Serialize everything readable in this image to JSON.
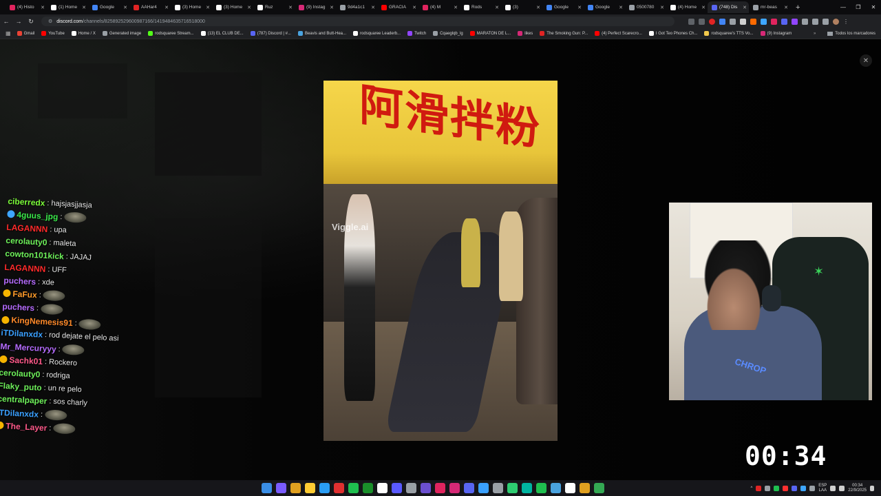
{
  "tabs": [
    {
      "title": "(4) Histo",
      "color": "#e0245e"
    },
    {
      "title": "(1) Home",
      "color": "#ffffff"
    },
    {
      "title": "Google",
      "color": "#4285f4"
    },
    {
      "title": "AAHar4",
      "color": "#e02424"
    },
    {
      "title": "(3) Home",
      "color": "#ffffff"
    },
    {
      "title": "(3) Home",
      "color": "#ffffff"
    },
    {
      "title": "Ruz",
      "color": "#ffffff"
    },
    {
      "title": "(9) Instag",
      "color": "#d62976"
    },
    {
      "title": "9d4a1c1",
      "color": "#9aa0a6"
    },
    {
      "title": "GRACIA",
      "color": "#ff0000"
    },
    {
      "title": "(4) M",
      "color": "#e0245e"
    },
    {
      "title": "Rods",
      "color": "#ffffff"
    },
    {
      "title": "(3)",
      "color": "#ffffff"
    },
    {
      "title": "Google",
      "color": "#4285f4"
    },
    {
      "title": "Google",
      "color": "#4285f4"
    },
    {
      "title": "0500780",
      "color": "#9aa0a6"
    },
    {
      "title": "(4) Home",
      "color": "#ffffff"
    },
    {
      "title": "(748) Dis",
      "color": "#5865f2",
      "active": true
    },
    {
      "title": "mr-beas",
      "color": "#9aa0a6"
    }
  ],
  "address_bar": {
    "host": "discord.com",
    "path": "/channels/825892529600987166/1419484635716518000"
  },
  "bookmarks": [
    {
      "label": "Gmail",
      "color": "#ea4335"
    },
    {
      "label": "YouTube",
      "color": "#ff0000"
    },
    {
      "label": "Home / X",
      "color": "#ffffff"
    },
    {
      "label": "Generated image",
      "color": "#9aa0a6"
    },
    {
      "label": "rodsquaree Stream...",
      "color": "#53fc18"
    },
    {
      "label": "(13) EL CLUB DE...",
      "color": "#ffffff"
    },
    {
      "label": "(787) Discord | #...",
      "color": "#5865f2"
    },
    {
      "label": "Beavis and Butt-Hea...",
      "color": "#4aa3df"
    },
    {
      "label": "rodsquaree Leaderb...",
      "color": "#ffffff"
    },
    {
      "label": "Twitch",
      "color": "#9146ff"
    },
    {
      "label": "Cqaeglqb_lg",
      "color": "#9aa0a6"
    },
    {
      "label": "MARATON DE L...",
      "color": "#ff0000"
    },
    {
      "label": "likes",
      "color": "#d62976"
    },
    {
      "label": "The Smoking Gun: P...",
      "color": "#e02424"
    },
    {
      "label": "(4) Perfect Scarecro...",
      "color": "#ff0000"
    },
    {
      "label": "I Got Teo Phones Ch...",
      "color": "#ffffff"
    },
    {
      "label": "rodsquaree's TTS Vo...",
      "color": "#f2c94c"
    },
    {
      "label": "(9) Instagram",
      "color": "#d62976"
    }
  ],
  "bookmarks_right": "Todos los marcadores",
  "chat": [
    {
      "user": "ciberredx",
      "color": "#7cfc3a",
      "text": "hajsjasjjasja"
    },
    {
      "user": "4guus_jpg",
      "color": "#3ae84a",
      "text": "",
      "emote": true,
      "badge": "#3ea6ff"
    },
    {
      "user": "LAGANNN",
      "color": "#ff2a2a",
      "text": "upa"
    },
    {
      "user": "cerolauty0",
      "color": "#6ef05a",
      "text": "maleta"
    },
    {
      "user": "cowton101kick",
      "color": "#6ef05a",
      "text": "JAJAJ"
    },
    {
      "user": "LAGANNN",
      "color": "#ff2a2a",
      "text": "UFF"
    },
    {
      "user": "puchers",
      "color": "#b66cff",
      "text": "xde"
    },
    {
      "user": "FaFux",
      "color": "#ff9b2a",
      "text": "",
      "emote": true,
      "badge": "#f5b400"
    },
    {
      "user": "puchers",
      "color": "#b66cff",
      "text": "",
      "emote": true
    },
    {
      "user": "KingNemesis91",
      "color": "#ff8a2a",
      "text": "",
      "emote": true,
      "badge": "#f5b400"
    },
    {
      "user": "iTDilanxdx",
      "color": "#3aa0ff",
      "text": "rod dejate el pelo asi"
    },
    {
      "user": "Mr_Mercuryyy",
      "color": "#b66cff",
      "text": "",
      "emote": true
    },
    {
      "user": "Sachk01",
      "color": "#ff5a8a",
      "text": "Rockero",
      "badge": "#f5b400"
    },
    {
      "user": "cerolauty0",
      "color": "#6ef05a",
      "text": "rodriga"
    },
    {
      "user": "Flaky_puto",
      "color": "#6ef05a",
      "text": "un re pelo"
    },
    {
      "user": "centralpaper",
      "color": "#6ef05a",
      "text": "sos charly"
    },
    {
      "user": "iTDilanxdx",
      "color": "#3aa0ff",
      "text": "",
      "emote": true
    },
    {
      "user": "The_Layer",
      "color": "#ff5a8a",
      "text": "",
      "emote": true,
      "badge": "#f5b400"
    }
  ],
  "video": {
    "sign_text": "阿滑拌粉",
    "watermark": "Viggle.ai"
  },
  "webcam": {
    "shirt_text": "CHROP"
  },
  "timer": "00:34",
  "taskbar": {
    "apps": [
      "#3a8ee6",
      "#7a5cff",
      "#e0a020",
      "#ffcc33",
      "#2a9df4",
      "#e03030",
      "#1fbf4f",
      "#1a8f2a",
      "#ffffff",
      "#5a5aff",
      "#9aa0a6",
      "#6b4fcf",
      "#e0245e",
      "#d62976",
      "#5865f2",
      "#3aa0ff",
      "#9aa0a6",
      "#2ecc71",
      "#00b4a0",
      "#1fbf4f",
      "#4aa3df",
      "#ffffff",
      "#e0a020",
      "#34a853"
    ],
    "lang_top": "ESP",
    "lang_bottom": "LAA",
    "time": "00:34",
    "date": "22/9/2025"
  }
}
